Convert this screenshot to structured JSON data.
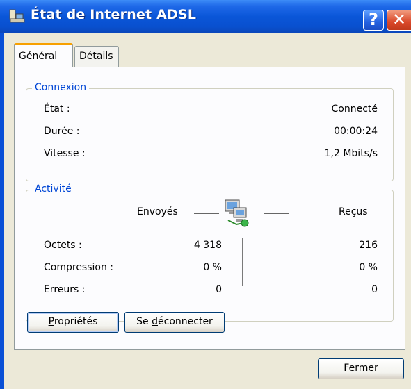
{
  "window": {
    "title": "État de Internet ADSL",
    "help_label": "?",
    "close_label": "✕"
  },
  "tabs": [
    {
      "label": "Général",
      "active": true
    },
    {
      "label": "Détails",
      "active": false
    }
  ],
  "connection": {
    "legend": "Connexion",
    "rows": [
      {
        "label": "État :",
        "value": "Connecté"
      },
      {
        "label": "Durée :",
        "value": "00:00:24"
      },
      {
        "label": "Vitesse :",
        "value": "1,2 Mbits/s"
      }
    ]
  },
  "activity": {
    "legend": "Activité",
    "sent_label": "Envoyés",
    "received_label": "Reçus",
    "rows": [
      {
        "label": "Octets :",
        "sent": "4 318",
        "received": "216"
      },
      {
        "label": "Compression :",
        "sent": "0 %",
        "received": "0 %"
      },
      {
        "label": "Erreurs :",
        "sent": "0",
        "received": "0"
      }
    ]
  },
  "buttons": {
    "properties_mnemonic": "P",
    "properties_rest": "ropriétés",
    "disconnect_prefix": "Se ",
    "disconnect_mnemonic": "d",
    "disconnect_rest": "éconnecter",
    "close_mnemonic": "F",
    "close_rest": "ermer"
  },
  "colors": {
    "titlebar": "#0a56d8",
    "legend_text": "#0046d5",
    "active_tab_accent": "#f7a000",
    "dialog_bg": "#ece9d8"
  }
}
